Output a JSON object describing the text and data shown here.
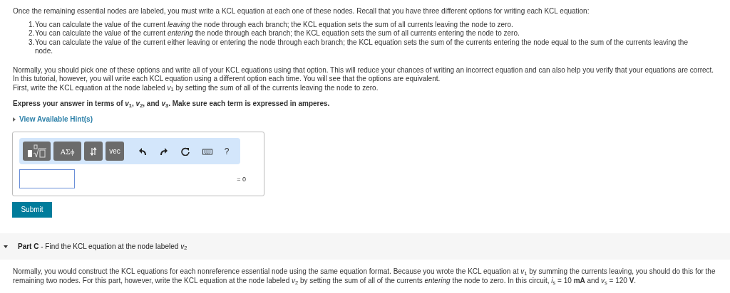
{
  "intro": "Once the remaining essential nodes are labeled, you must write a KCL equation at each one of these nodes. Recall that you have three different options for writing each KCL equation:",
  "options": [
    {
      "number": "1.",
      "text": "You can calculate the value of the current *leaving* the node through each branch; the KCL equation sets the sum of all currents leaving the node to zero."
    },
    {
      "number": "2.",
      "text": "You can calculate the value of the current *entering* the node through each branch; the KCL equation sets the sum of all currents entering the node to zero."
    },
    {
      "number": "3.",
      "text": "You can calculate the value of the current either leaving or entering the node through each branch; the KCL equation sets the sum of the currents entering the node equal to the sum of the currents leaving the node."
    }
  ],
  "paragraph": "Normally, you should pick one of these options and write all of your KCL equations using that option. This will reduce your chances of writing an incorrect equation and can also help you verify that your equations are correct. In this tutorial, however, you will write each KCL equation using a different option each time. You will see that the options are equivalent.",
  "instruction": "First, write the KCL equation at the node labeled *v*$_{1}$ by setting the sum of all of the currents leaving the node to zero.",
  "prompt": "Express your answer in terms of *v*$_{1}$, *v*$_{2}$, and *v*$_{3}$. Make sure each term is expressed in amperes.",
  "hint": {
    "label": "View Available Hint(s)",
    "expanded": false
  },
  "toolbar": {
    "symbols_label": "ΑΣϕ",
    "vec_label": "vec",
    "help_label": "?"
  },
  "answer": {
    "suffix": "= 0"
  },
  "submit": "Submit",
  "part_c": {
    "expanded": true,
    "label": "Part C",
    "title": " - Find the KCL equation at the node labeled *v*$_{2}$"
  },
  "part_c_text": "Normally, you would construct the KCL equations for each nonreference essential node using the same equation format. Because you wrote the KCL equation at *v*$_{1}$ by summing the currents leaving, you should do this for the remaining two nodes. For this part, however, write the KCL equation at the node labeled *v*$_{2}$ by setting the sum of all of the currents *entering* the node to zero. In this circuit, *i*$_{s}$ = 10 **mA** and *v*$_{s}$ = 120 **V**."
}
